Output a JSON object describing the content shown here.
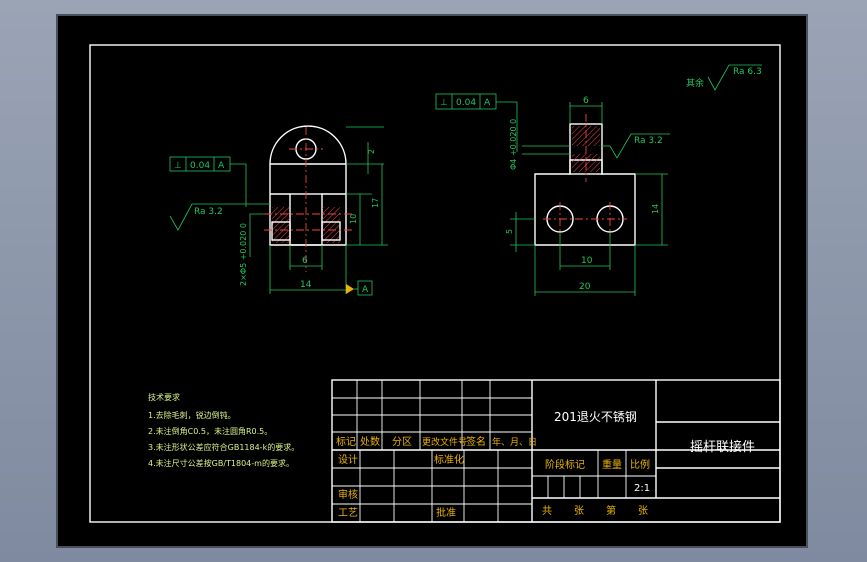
{
  "surface_finish": {
    "label": "其余",
    "value": "Ra 6.3"
  },
  "left_view": {
    "tol_symbol": "⊥",
    "tol_value": "0.04",
    "tol_datum": "A",
    "roughness": "Ra 3.2",
    "dims": {
      "h2": "2",
      "h17": "17",
      "h10": "10",
      "w6": "6",
      "w14": "14",
      "holes": "2×Φ5 +0.020 0"
    },
    "datum_label": "A"
  },
  "right_view": {
    "tol_symbol": "⊥",
    "tol_value": "0.04",
    "tol_datum": "A",
    "roughness": "Ra 3.2",
    "dims": {
      "w6": "6",
      "dia": "Φ4 +0.020 0",
      "h14": "14",
      "h5": "5",
      "w10": "10",
      "w20": "20"
    }
  },
  "tech_notes": {
    "title": "技术要求",
    "items": [
      "1.去除毛刺，锐边倒钝。",
      "2.未注倒角C0.5，未注圆角R0.5。",
      "3.未注形状公差应符合GB1184-k的要求。",
      "4.未注尺寸公差按GB/T1804-m的要求。"
    ]
  },
  "title_block": {
    "material": "201退火不锈钢",
    "part_name": "摇杆联接件",
    "row_headers": [
      "标记",
      "处数",
      "分区",
      "更改文件号",
      "签名",
      "年、月、日"
    ],
    "design": "设计",
    "standardize": "标准化",
    "stage_mark": "阶段标记",
    "weight": "重量",
    "scale": "比例",
    "scale_value": "2:1",
    "review": "审核",
    "process": "工艺",
    "approve": "批准",
    "sheets": [
      "共",
      "张",
      "第",
      "张"
    ]
  }
}
